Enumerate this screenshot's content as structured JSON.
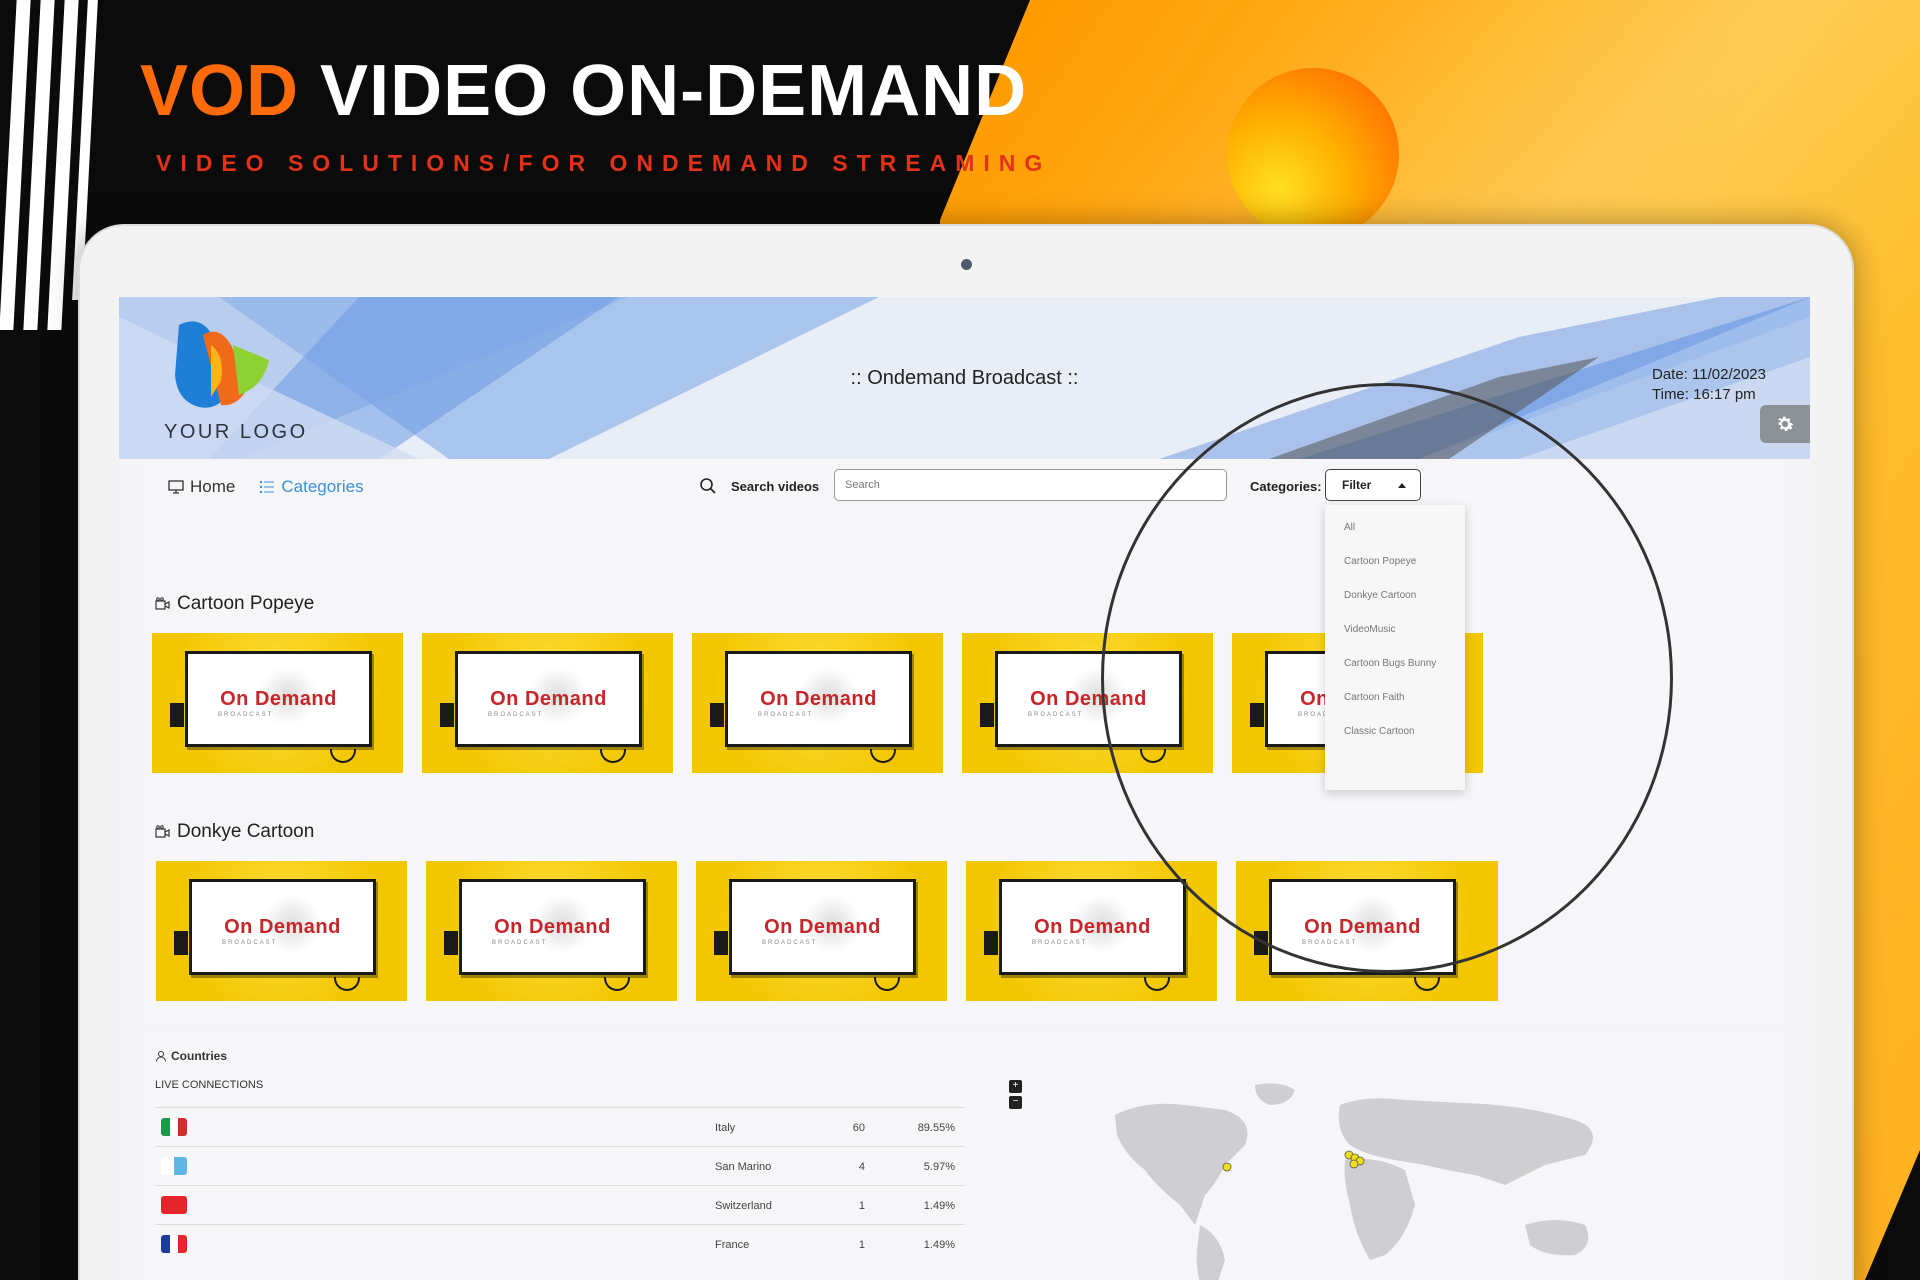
{
  "hero": {
    "accent": "VOD",
    "title": "VIDEO ON-DEMAND",
    "subtitle": "VIDEO SOLUTIONS/FOR ONDEMAND STREAMING"
  },
  "header": {
    "logo_text": "YOUR LOGO",
    "title": ":: Ondemand Broadcast ::",
    "date": "Date: 11/02/2023",
    "time": "Time: 16:17 pm"
  },
  "nav": {
    "home": "Home",
    "categories": "Categories"
  },
  "search": {
    "label": "Search videos",
    "placeholder": "Search"
  },
  "filter": {
    "label": "Categories:",
    "button": "Filter",
    "options": [
      "All",
      "Cartoon Popeye",
      "Donkye Cartoon",
      "VideoMusic",
      "Cartoon Bugs Bunny",
      "Cartoon Faith",
      "Classic Cartoon"
    ]
  },
  "sections": [
    {
      "title": "Cartoon Popeye",
      "thumb_title": "On Demand",
      "thumb_sub": "BROADCAST",
      "count": 5
    },
    {
      "title": "Donkye Cartoon",
      "thumb_title": "On Demand",
      "thumb_sub": "BROADCAST",
      "count": 5
    }
  ],
  "countries": {
    "title": "Countries",
    "live_label": "LIVE CONNECTIONS",
    "rows": [
      {
        "name": "Italy",
        "count": "60",
        "percent": "89.55%",
        "flag": [
          "#1a9a47",
          "#ffffff",
          "#d52b2b"
        ]
      },
      {
        "name": "San Marino",
        "count": "4",
        "percent": "5.97%",
        "flag": [
          "#ffffff",
          "#5eb6e4"
        ]
      },
      {
        "name": "Switzerland",
        "count": "1",
        "percent": "1.49%",
        "flag": [
          "#e3262b"
        ]
      },
      {
        "name": "France",
        "count": "1",
        "percent": "1.49%",
        "flag": [
          "#1d3d9c",
          "#ffffff",
          "#e3262b"
        ]
      }
    ],
    "zoom_in": "+",
    "zoom_out": "−"
  },
  "colors": {
    "accent_orange": "#ff6a0a",
    "link_blue": "#3b8fd6",
    "thumb_yellow": "#f3cd00",
    "thumb_red": "#c6262a"
  }
}
